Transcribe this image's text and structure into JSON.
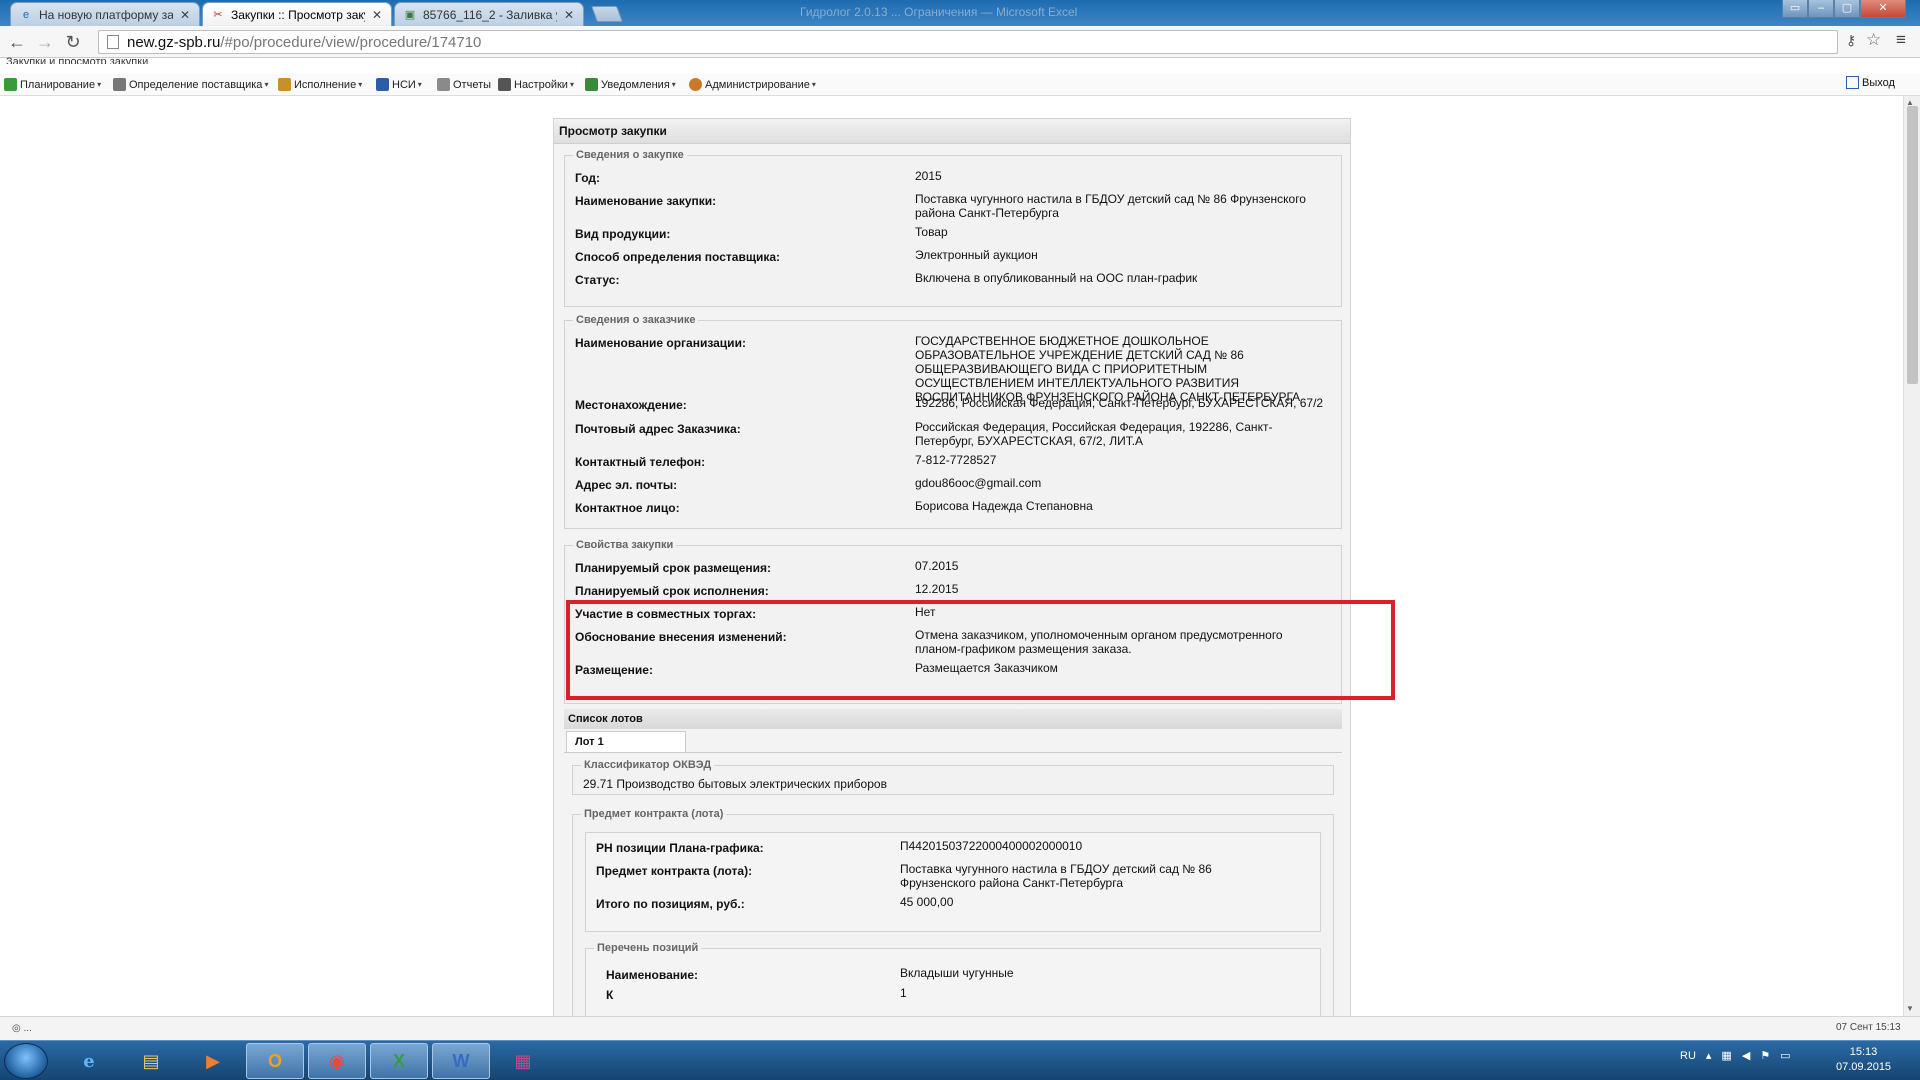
{
  "browser": {
    "tabs": [
      {
        "title": "На новую платформу за",
        "icon": "ie-icon",
        "active": false
      },
      {
        "title": "Закупки :: Просмотр заку",
        "icon": "tools-icon",
        "active": true
      },
      {
        "title": "85766_116_2 - Заливка у",
        "icon": "image-icon",
        "active": false
      }
    ],
    "window_title": "Гидролог 2.0.13 ... Ограничения — Microsoft Excel",
    "url_host": "new.gz-spb.ru",
    "url_path": "/#po/procedure/view/procedure/174710"
  },
  "app": {
    "breadcrumb": "Закупки и просмотр закупки",
    "menu": [
      {
        "label": "Планирование",
        "color": "#3a9a3a",
        "caret": "▾"
      },
      {
        "label": "Определение поставщика",
        "color": "#777777",
        "caret": "▾"
      },
      {
        "label": "Исполнение",
        "color": "#c8902a",
        "caret": "▾"
      },
      {
        "label": "НСИ",
        "color": "#2a5fa8",
        "caret": "▾"
      },
      {
        "label": "Отчеты",
        "color": "#8a8a8a",
        "caret": ""
      },
      {
        "label": "Настройки",
        "color": "#555555",
        "caret": "▾"
      },
      {
        "label": "Уведомления",
        "color": "#3a8a3a",
        "caret": "▾"
      },
      {
        "label": "Администрирование",
        "color": "#c87a2a",
        "caret": "▾"
      }
    ],
    "exit_label": "Выход"
  },
  "panel": {
    "title": "Просмотр закупки",
    "purchase_info": {
      "legend": "Сведения о закупке",
      "rows": [
        {
          "label": "Год:",
          "value": "2015"
        },
        {
          "label": "Наименование закупки:",
          "value": "Поставка чугунного настила в ГБДОУ детский сад № 86 Фрунзенского района Санкт-Петербурга"
        },
        {
          "label": "Вид продукции:",
          "value": "Товар"
        },
        {
          "label": "Способ определения поставщика:",
          "value": "Электронный аукцион"
        },
        {
          "label": "Статус:",
          "value": "Включена в опубликованный на ООС план-график"
        }
      ]
    },
    "customer_info": {
      "legend": "Сведения о заказчике",
      "rows": [
        {
          "label": "Наименование организации:",
          "value": "ГОСУДАРСТВЕННОЕ БЮДЖЕТНОЕ ДОШКОЛЬНОЕ ОБРАЗОВАТЕЛЬНОЕ УЧРЕЖДЕНИЕ ДЕТСКИЙ САД № 86 ОБЩЕРАЗВИВАЮЩЕГО ВИДА С ПРИОРИТЕТНЫМ ОСУЩЕСТВЛЕНИЕМ ИНТЕЛЛЕКТУАЛЬНОГО РАЗВИТИЯ ВОСПИТАННИКОВ ФРУНЗЕНСКОГО РАЙОНА САНКТ-ПЕТЕРБУРГА"
        },
        {
          "label": "Местонахождение:",
          "value": "192286, Российская Федерация, Санкт-Петербург, БУХАРЕСТСКАЯ, 67/2"
        },
        {
          "label": "Почтовый адрес Заказчика:",
          "value": "Российская Федерация, Российская Федерация, 192286, Санкт-Петербург, БУХАРЕСТСКАЯ, 67/2, ЛИТ.А"
        },
        {
          "label": "Контактный телефон:",
          "value": "7-812-7728527"
        },
        {
          "label": "Адрес эл. почты:",
          "value": "gdou86ooc@gmail.com"
        },
        {
          "label": "Контактное лицо:",
          "value": "Борисова Надежда Степановна"
        }
      ]
    },
    "properties": {
      "legend": "Свойства закупки",
      "rows": [
        {
          "label": "Планируемый срок размещения:",
          "value": "07.2015"
        },
        {
          "label": "Планируемый срок исполнения:",
          "value": "12.2015"
        },
        {
          "label": "Участие в совместных торгах:",
          "value": "Нет"
        },
        {
          "label": "Обоснование внесения изменений:",
          "value": "Отмена заказчиком, уполномоченным органом предусмотренного планом-графиком размещения заказа."
        },
        {
          "label": "Размещение:",
          "value": "Размещается Заказчиком"
        }
      ]
    },
    "lots": {
      "header": "Список лотов",
      "tab_label": "Лот 1",
      "okved_legend": "Классификатор ОКВЭД",
      "okved_value": "29.71 Производство бытовых электрических приборов",
      "subject_legend": "Предмет контракта (лота)",
      "subject_rows": [
        {
          "label": "РН позиции Плана-графика:",
          "value": "П44201503722000400002000010"
        },
        {
          "label": "Предмет контракта (лота):",
          "value": "Поставка чугунного настила в ГБДОУ детский сад № 86 Фрунзенского района Санкт-Петербурга"
        },
        {
          "label": "Итого по позициям, руб.:",
          "value": "45 000,00"
        }
      ],
      "positions_legend": "Перечень позиций",
      "positions_rows": [
        {
          "label": "Наименование:",
          "value": "Вкладыши чугунные"
        },
        {
          "label": "К",
          "value": "1"
        }
      ]
    }
  },
  "status": {
    "left": "◎ ...",
    "right": "07 Сент 15:13"
  },
  "taskbar": {
    "lang": "RU",
    "time": "15:13",
    "date": "07.09.2015"
  }
}
